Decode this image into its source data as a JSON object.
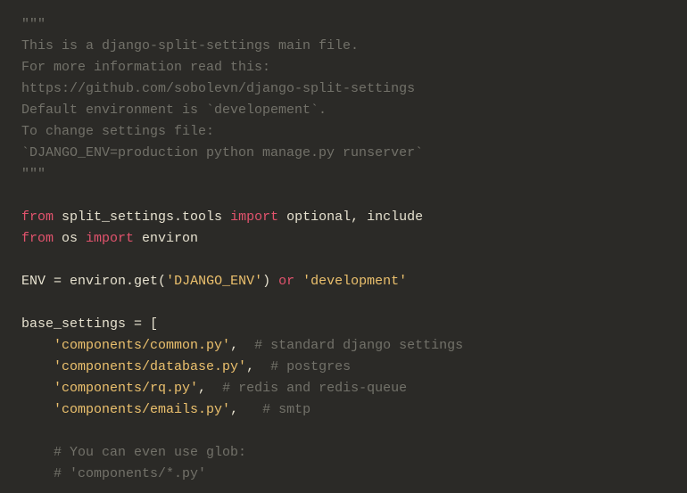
{
  "code": {
    "docstring": {
      "open": "\"\"\"",
      "l1": "This is a django-split-settings main file.",
      "l2": "For more information read this:",
      "l3": "https://github.com/sobolevn/django-split-settings",
      "l4": "Default environment is `developement`.",
      "l5": "To change settings file:",
      "l6": "`DJANGO_ENV=production python manage.py runserver`",
      "close": "\"\"\""
    },
    "kw": {
      "from": "from",
      "import": "import",
      "or": "or"
    },
    "imp1": {
      "module": " split_settings.tools ",
      "names": " optional, include"
    },
    "imp2": {
      "module": " os ",
      "names": " environ"
    },
    "env": {
      "lhs": "ENV ",
      "eq": "=",
      "call_pre": " environ.get(",
      "arg": "'DJANGO_ENV'",
      "call_post": ") ",
      "default": " 'development'"
    },
    "base": {
      "lhs": "base_settings ",
      "eq": "=",
      "bracket_open": " [",
      "items": [
        {
          "value": "'components/common.py'",
          "comma": ",",
          "gap": "  ",
          "comment": "# standard django settings"
        },
        {
          "value": "'components/database.py'",
          "comma": ",",
          "gap": "  ",
          "comment": "# postgres"
        },
        {
          "value": "'components/rq.py'",
          "comma": ",",
          "gap": "  ",
          "comment": "# redis and redis-queue"
        },
        {
          "value": "'components/emails.py'",
          "comma": ",",
          "gap": "   ",
          "comment": "# smtp"
        }
      ],
      "tail_comment1": "# You can even use glob:",
      "tail_comment2": "# 'components/*.py'"
    },
    "indent": "    "
  }
}
